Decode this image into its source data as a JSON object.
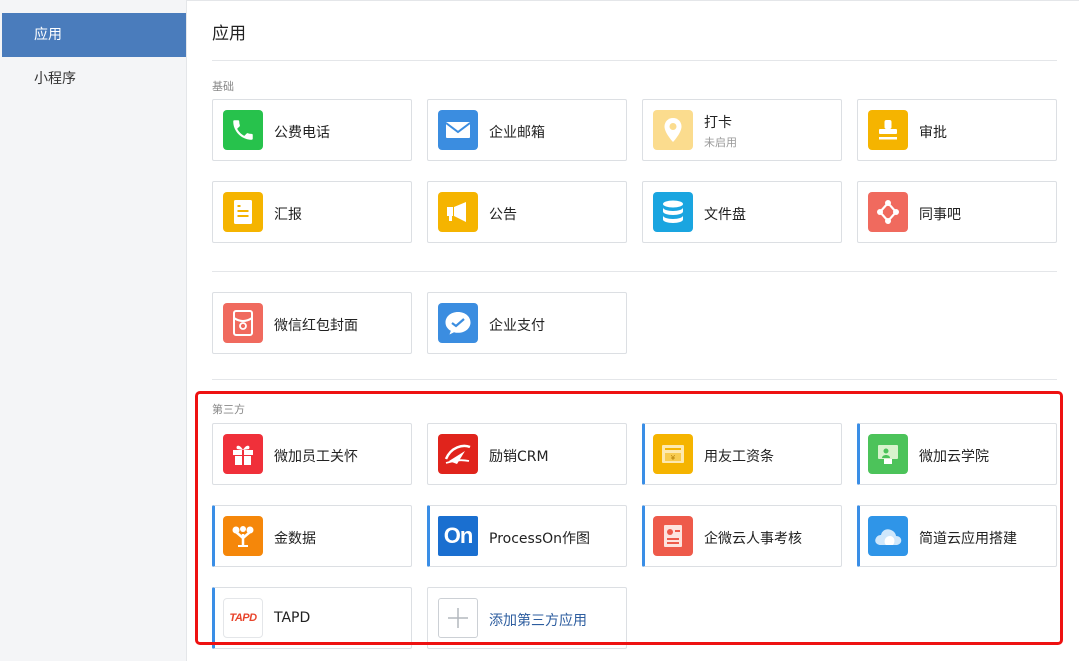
{
  "sidebar": {
    "items": [
      {
        "label": "应用"
      },
      {
        "label": "小程序"
      }
    ]
  },
  "page": {
    "title": "应用"
  },
  "sections": {
    "basic": {
      "label": "基础",
      "apps": [
        {
          "name": "公费电话",
          "icon": "phone-icon",
          "color": "#27c24c"
        },
        {
          "name": "企业邮箱",
          "icon": "mail-icon",
          "color": "#3b8de0"
        },
        {
          "name": "打卡",
          "status": "未启用",
          "icon": "location-pin-icon",
          "color": "#fbdc8e"
        },
        {
          "name": "审批",
          "icon": "stamp-icon",
          "color": "#f5b400"
        },
        {
          "name": "汇报",
          "icon": "report-icon",
          "color": "#f5b400"
        },
        {
          "name": "公告",
          "icon": "megaphone-icon",
          "color": "#f5b400"
        },
        {
          "name": "文件盘",
          "icon": "database-icon",
          "color": "#1aa5e0"
        },
        {
          "name": "同事吧",
          "icon": "share-icon",
          "color": "#f06a5e"
        }
      ]
    },
    "extra": {
      "apps": [
        {
          "name": "微信红包封面",
          "icon": "red-envelope-icon",
          "color": "#f06a5e"
        },
        {
          "name": "企业支付",
          "icon": "pay-icon",
          "color": "#3b8de0"
        }
      ]
    },
    "third_party": {
      "label": "第三方",
      "apps": [
        {
          "name": "微加员工关怀",
          "icon": "gift-icon",
          "color": "#f0303a"
        },
        {
          "name": "励销CRM",
          "icon": "crm-icon",
          "color": "#e0241c"
        },
        {
          "name": "用友工资条",
          "icon": "payslip-icon",
          "color": "#f5b400"
        },
        {
          "name": "微加云学院",
          "icon": "classroom-icon",
          "color": "#4cc35a"
        },
        {
          "name": "金数据",
          "icon": "tree-icon",
          "color": "#f5870a"
        },
        {
          "name": "ProcessOn作图",
          "icon": "processon-icon",
          "color": "#1a6fd0"
        },
        {
          "name": "企微云人事考核",
          "icon": "resume-icon",
          "color": "#ee5a4a"
        },
        {
          "name": "简道云应用搭建",
          "icon": "cloud-icon",
          "color": "#2f95e8"
        },
        {
          "name": "TAPD",
          "icon": "tapd-icon",
          "color": "#ffffff"
        }
      ],
      "add_label": "添加第三方应用",
      "add_icon": "plus-icon"
    }
  },
  "icon_text": {
    "processon": "On",
    "tapd": "TAPD"
  }
}
